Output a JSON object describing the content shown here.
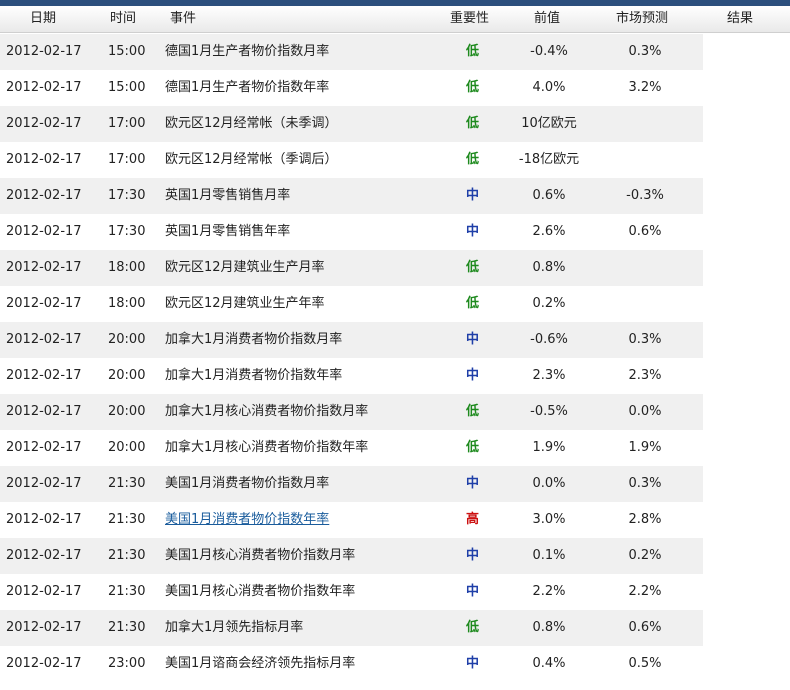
{
  "header": {
    "date": "日期",
    "time": "时间",
    "event": "事件",
    "importance": "重要性",
    "previous": "前值",
    "forecast": "市场预测",
    "result": "结果"
  },
  "rows": [
    {
      "date": "2012-02-17",
      "time": "15:00",
      "event": "德国1月生产者物价指数月率",
      "importance": "低",
      "level": "low",
      "previous": "-0.4%",
      "forecast": "0.3%",
      "result": ""
    },
    {
      "date": "2012-02-17",
      "time": "15:00",
      "event": "德国1月生产者物价指数年率",
      "importance": "低",
      "level": "low",
      "previous": "4.0%",
      "forecast": "3.2%",
      "result": ""
    },
    {
      "date": "2012-02-17",
      "time": "17:00",
      "event": "欧元区12月经常帐（未季调）",
      "importance": "低",
      "level": "low",
      "previous": "10亿欧元",
      "forecast": "",
      "result": ""
    },
    {
      "date": "2012-02-17",
      "time": "17:00",
      "event": "欧元区12月经常帐（季调后）",
      "importance": "低",
      "level": "low",
      "previous": "-18亿欧元",
      "forecast": "",
      "result": ""
    },
    {
      "date": "2012-02-17",
      "time": "17:30",
      "event": "英国1月零售销售月率",
      "importance": "中",
      "level": "mid",
      "previous": "0.6%",
      "forecast": "-0.3%",
      "result": ""
    },
    {
      "date": "2012-02-17",
      "time": "17:30",
      "event": "英国1月零售销售年率",
      "importance": "中",
      "level": "mid",
      "previous": "2.6%",
      "forecast": "0.6%",
      "result": ""
    },
    {
      "date": "2012-02-17",
      "time": "18:00",
      "event": "欧元区12月建筑业生产月率",
      "importance": "低",
      "level": "low",
      "previous": "0.8%",
      "forecast": "",
      "result": ""
    },
    {
      "date": "2012-02-17",
      "time": "18:00",
      "event": "欧元区12月建筑业生产年率",
      "importance": "低",
      "level": "low",
      "previous": "0.2%",
      "forecast": "",
      "result": ""
    },
    {
      "date": "2012-02-17",
      "time": "20:00",
      "event": "加拿大1月消费者物价指数月率",
      "importance": "中",
      "level": "mid",
      "previous": "-0.6%",
      "forecast": "0.3%",
      "result": ""
    },
    {
      "date": "2012-02-17",
      "time": "20:00",
      "event": "加拿大1月消费者物价指数年率",
      "importance": "中",
      "level": "mid",
      "previous": "2.3%",
      "forecast": "2.3%",
      "result": ""
    },
    {
      "date": "2012-02-17",
      "time": "20:00",
      "event": "加拿大1月核心消费者物价指数月率",
      "importance": "低",
      "level": "low",
      "previous": "-0.5%",
      "forecast": "0.0%",
      "result": ""
    },
    {
      "date": "2012-02-17",
      "time": "20:00",
      "event": "加拿大1月核心消费者物价指数年率",
      "importance": "低",
      "level": "low",
      "previous": "1.9%",
      "forecast": "1.9%",
      "result": ""
    },
    {
      "date": "2012-02-17",
      "time": "21:30",
      "event": "美国1月消费者物价指数月率",
      "importance": "中",
      "level": "mid",
      "previous": "0.0%",
      "forecast": "0.3%",
      "result": ""
    },
    {
      "date": "2012-02-17",
      "time": "21:30",
      "event": "美国1月消费者物价指数年率",
      "importance": "高",
      "level": "high",
      "previous": "3.0%",
      "forecast": "2.8%",
      "result": "",
      "link": true
    },
    {
      "date": "2012-02-17",
      "time": "21:30",
      "event": "美国1月核心消费者物价指数月率",
      "importance": "中",
      "level": "mid",
      "previous": "0.1%",
      "forecast": "0.2%",
      "result": ""
    },
    {
      "date": "2012-02-17",
      "time": "21:30",
      "event": "美国1月核心消费者物价指数年率",
      "importance": "中",
      "level": "mid",
      "previous": "2.2%",
      "forecast": "2.2%",
      "result": ""
    },
    {
      "date": "2012-02-17",
      "time": "21:30",
      "event": "加拿大1月领先指标月率",
      "importance": "低",
      "level": "low",
      "previous": "0.8%",
      "forecast": "0.6%",
      "result": ""
    },
    {
      "date": "2012-02-17",
      "time": "23:00",
      "event": "美国1月谘商会经济领先指标月率",
      "importance": "中",
      "level": "mid",
      "previous": "0.4%",
      "forecast": "0.5%",
      "result": ""
    }
  ]
}
